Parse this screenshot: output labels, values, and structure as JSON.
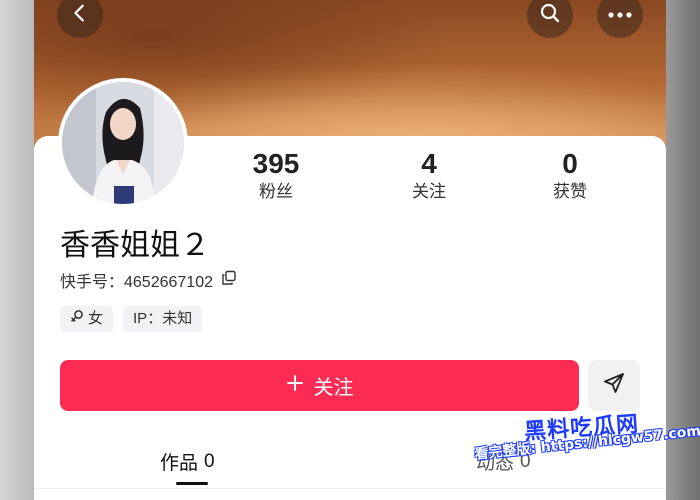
{
  "profile": {
    "name": "香香姐姐２",
    "uid_label": "快手号：4652667102",
    "tags": [
      "女",
      "IP：未知"
    ]
  },
  "stats": [
    {
      "value": "395",
      "label": "粉丝"
    },
    {
      "value": "4",
      "label": "关注"
    },
    {
      "value": "0",
      "label": "获赞"
    }
  ],
  "actions": {
    "follow_label": "关注"
  },
  "tabs": [
    {
      "label": "作品",
      "count": "0"
    },
    {
      "label": "动态",
      "count": "0"
    }
  ],
  "watermark": {
    "title": "黑料吃瓜网",
    "url_line": "看完整版: https://hlcgw57.com"
  },
  "icons": {
    "back": "chevron-left-icon",
    "search": "search-icon",
    "more": "more-icon",
    "copy": "copy-icon",
    "gender": "female-icon",
    "share": "send-icon"
  },
  "colors": {
    "accent": "#fe2c55",
    "text": "#111111"
  }
}
